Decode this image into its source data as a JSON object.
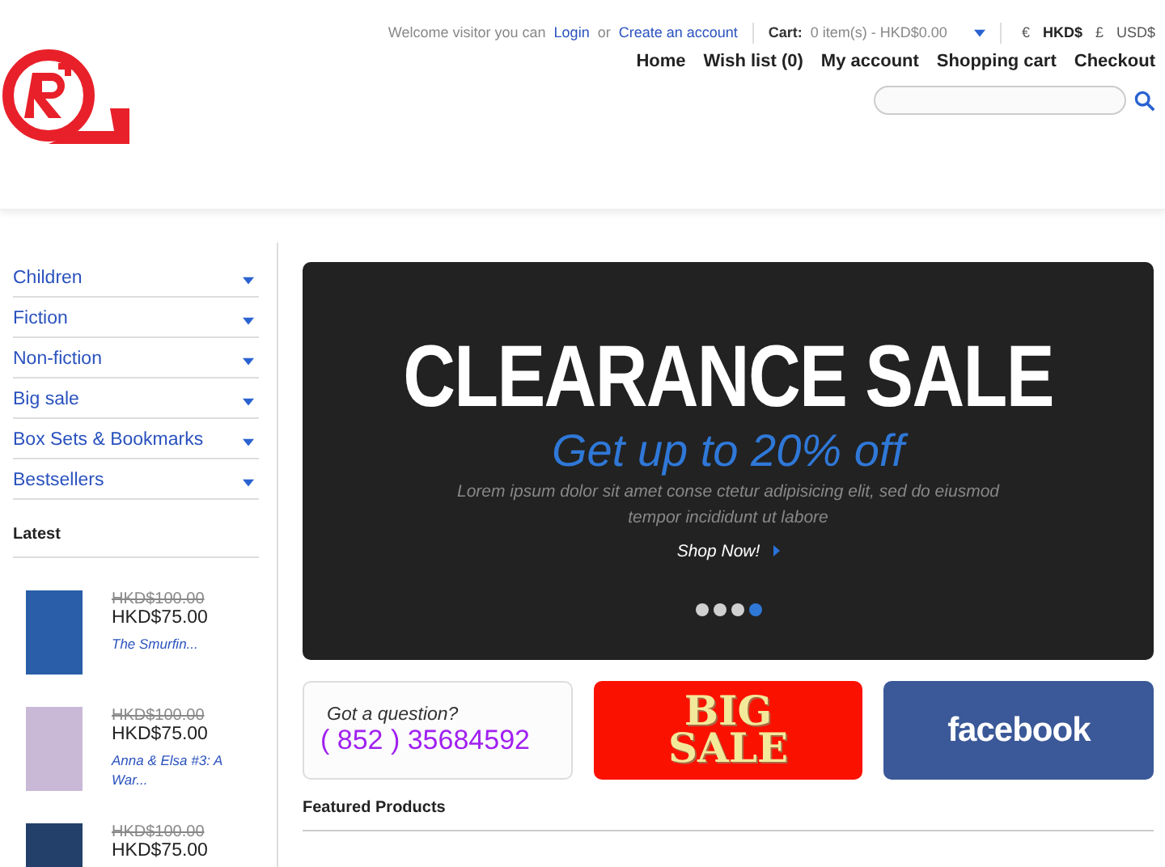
{
  "top_bar": {
    "welcome": "Welcome visitor you can",
    "login": "Login",
    "or": "or",
    "create_account": "Create an account",
    "cart_label": "Cart:",
    "cart_value": "0 item(s) - HKD$0.00",
    "currencies": [
      {
        "label": "€",
        "selected": false
      },
      {
        "label": "HKD$",
        "selected": true
      },
      {
        "label": "£",
        "selected": false
      },
      {
        "label": "USD$",
        "selected": false
      }
    ]
  },
  "nav": [
    "Home",
    "Wish list (0)",
    "My account",
    "Shopping cart",
    "Checkout"
  ],
  "categories": [
    "Children",
    "Fiction",
    "Non-fiction",
    "Big sale",
    "Box Sets & Bookmarks",
    "Bestsellers"
  ],
  "latest": {
    "title": "Latest",
    "items": [
      {
        "old_price": "HKD$100.00",
        "price": "HKD$75.00",
        "title": "The Smurfin...",
        "color": "#2a5ea8"
      },
      {
        "old_price": "HKD$100.00",
        "price": "HKD$75.00",
        "title": "Anna & Elsa #3: A War...",
        "color": "#c9b9d6"
      },
      {
        "old_price": "HKD$100.00",
        "price": "HKD$75.00",
        "color": "#23406a"
      }
    ]
  },
  "slider": {
    "title": "CLEARANCE SALE",
    "subtitle": "Get up to 20% off",
    "text": "Lorem ipsum dolor sit amet conse ctetur adipisicing elit, sed do eiusmod tempor incididunt ut labore",
    "cta": "Shop Now!",
    "dots": [
      {
        "selected": false
      },
      {
        "selected": false
      },
      {
        "selected": false
      },
      {
        "selected": true
      }
    ]
  },
  "banners": [
    {
      "kind": "phone",
      "question": "Got a question?",
      "phone": "( 852 ) 35684592"
    },
    {
      "kind": "sale",
      "text": "BIG SALE"
    },
    {
      "kind": "facebook",
      "text": "facebook"
    }
  ],
  "featured": {
    "title": "Featured Products"
  }
}
